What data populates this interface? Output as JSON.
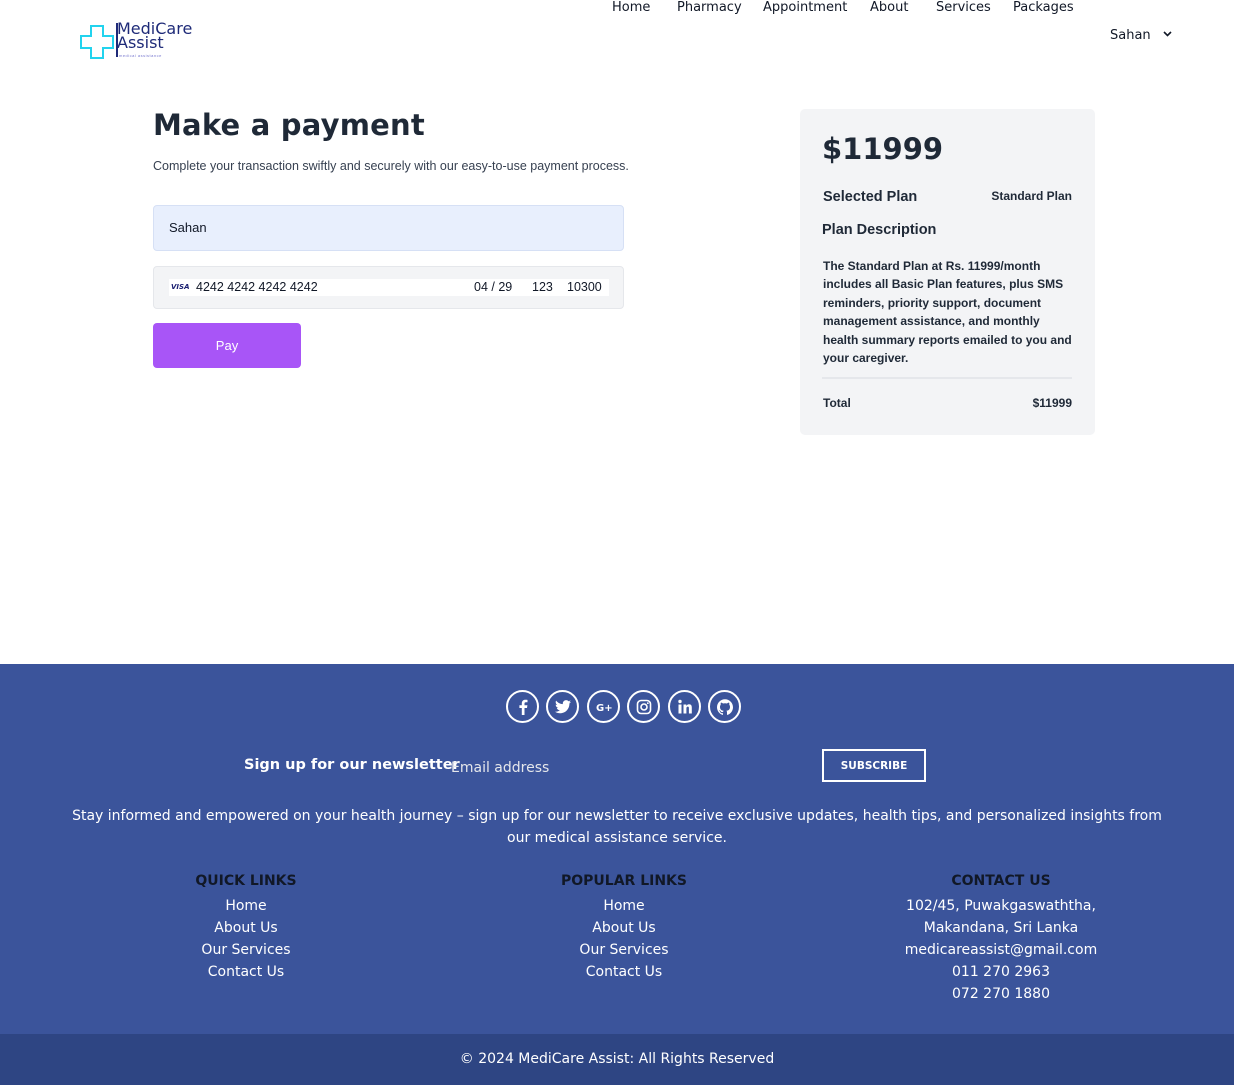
{
  "brand": {
    "name_line1": "MediCare",
    "name_line2": "Assist",
    "tagline": "medical assistance"
  },
  "nav": {
    "items": [
      "Home",
      "Pharmacy",
      "Appointment",
      "About",
      "Services",
      "Packages"
    ],
    "user": "Sahan"
  },
  "payment": {
    "title": "Make a payment",
    "subtitle": "Complete your transaction swiftly and securely with our easy-to-use payment process.",
    "name_value": "Sahan",
    "card_brand": "VISA",
    "card_number": "4242 4242 4242 4242",
    "card_expiry": "04 / 29",
    "card_cvc": "123",
    "card_zip": "10300",
    "pay_label": "Pay"
  },
  "summary": {
    "price": "$11999",
    "selected_plan_label": "Selected Plan",
    "selected_plan_value": "Standard Plan",
    "description_label": "Plan Description",
    "description": "The Standard Plan at Rs. 11999/month includes all Basic Plan features, plus SMS reminders, priority support, document management assistance, and monthly health summary reports emailed to you and your caregiver.",
    "total_label": "Total",
    "total_value": "$11999"
  },
  "footer": {
    "socials": [
      "facebook-icon",
      "twitter-icon",
      "google-plus-icon",
      "instagram-icon",
      "linkedin-icon",
      "github-icon"
    ],
    "newsletter_label": "Sign up for our newsletter",
    "email_placeholder": "Email address",
    "subscribe_label": "SUBSCRIBE",
    "newsletter_text": "Stay informed and empowered on your health journey – sign up for our newsletter to receive exclusive updates, health tips, and personalized insights from our medical assistance service.",
    "quick_links": {
      "title": "QUICK LINKS",
      "items": [
        "Home",
        "About Us",
        "Our Services",
        "Contact Us"
      ]
    },
    "popular_links": {
      "title": "POPULAR LINKS",
      "items": [
        "Home",
        "About Us",
        "Our Services",
        "Contact Us"
      ]
    },
    "contact": {
      "title": "CONTACT US",
      "lines": [
        "102/45, Puwakgaswaththa,",
        "Makandana, Sri Lanka",
        "medicareassist@gmail.com",
        "011 270 2963",
        "072 270 1880"
      ]
    },
    "copyright": "© 2024 MediCare Assist: All Rights Reserved"
  },
  "colors": {
    "accent": "#a855f7",
    "footer_bg": "#3b549b",
    "footer_bottom": "#2e4583",
    "brand_cyan": "#22d3ee",
    "brand_navy": "#1e2a78"
  }
}
